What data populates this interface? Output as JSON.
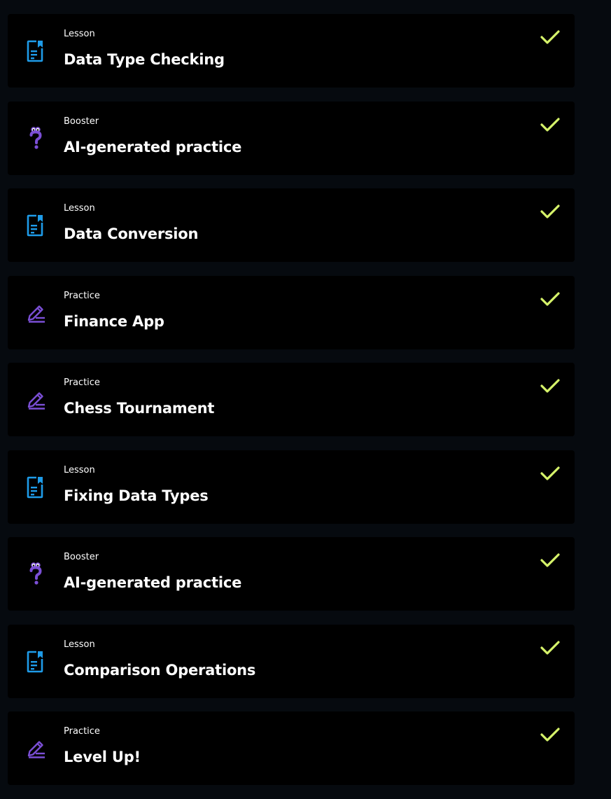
{
  "colors": {
    "page_bg": "#060a0f",
    "card_bg": "#000000",
    "text": "#ffffff",
    "lesson_icon": "#1e9be8",
    "booster_icon": "#7b4fd6",
    "practice_icon": "#7b4fd6",
    "check": "#d6f36a"
  },
  "items": [
    {
      "type": "Lesson",
      "title": "Data Type Checking",
      "icon": "document-bookmark-icon",
      "completed": true
    },
    {
      "type": "Booster",
      "title": "AI-generated practice",
      "icon": "question-mark-icon",
      "completed": true
    },
    {
      "type": "Lesson",
      "title": "Data Conversion",
      "icon": "document-bookmark-icon",
      "completed": true
    },
    {
      "type": "Practice",
      "title": "Finance App",
      "icon": "pencil-icon",
      "completed": true
    },
    {
      "type": "Practice",
      "title": "Chess Tournament",
      "icon": "pencil-icon",
      "completed": true
    },
    {
      "type": "Lesson",
      "title": "Fixing Data Types",
      "icon": "document-bookmark-icon",
      "completed": true
    },
    {
      "type": "Booster",
      "title": "AI-generated practice",
      "icon": "question-mark-icon",
      "completed": true
    },
    {
      "type": "Lesson",
      "title": "Comparison Operations",
      "icon": "document-bookmark-icon",
      "completed": true
    },
    {
      "type": "Practice",
      "title": "Level Up!",
      "icon": "pencil-icon",
      "completed": true
    }
  ]
}
